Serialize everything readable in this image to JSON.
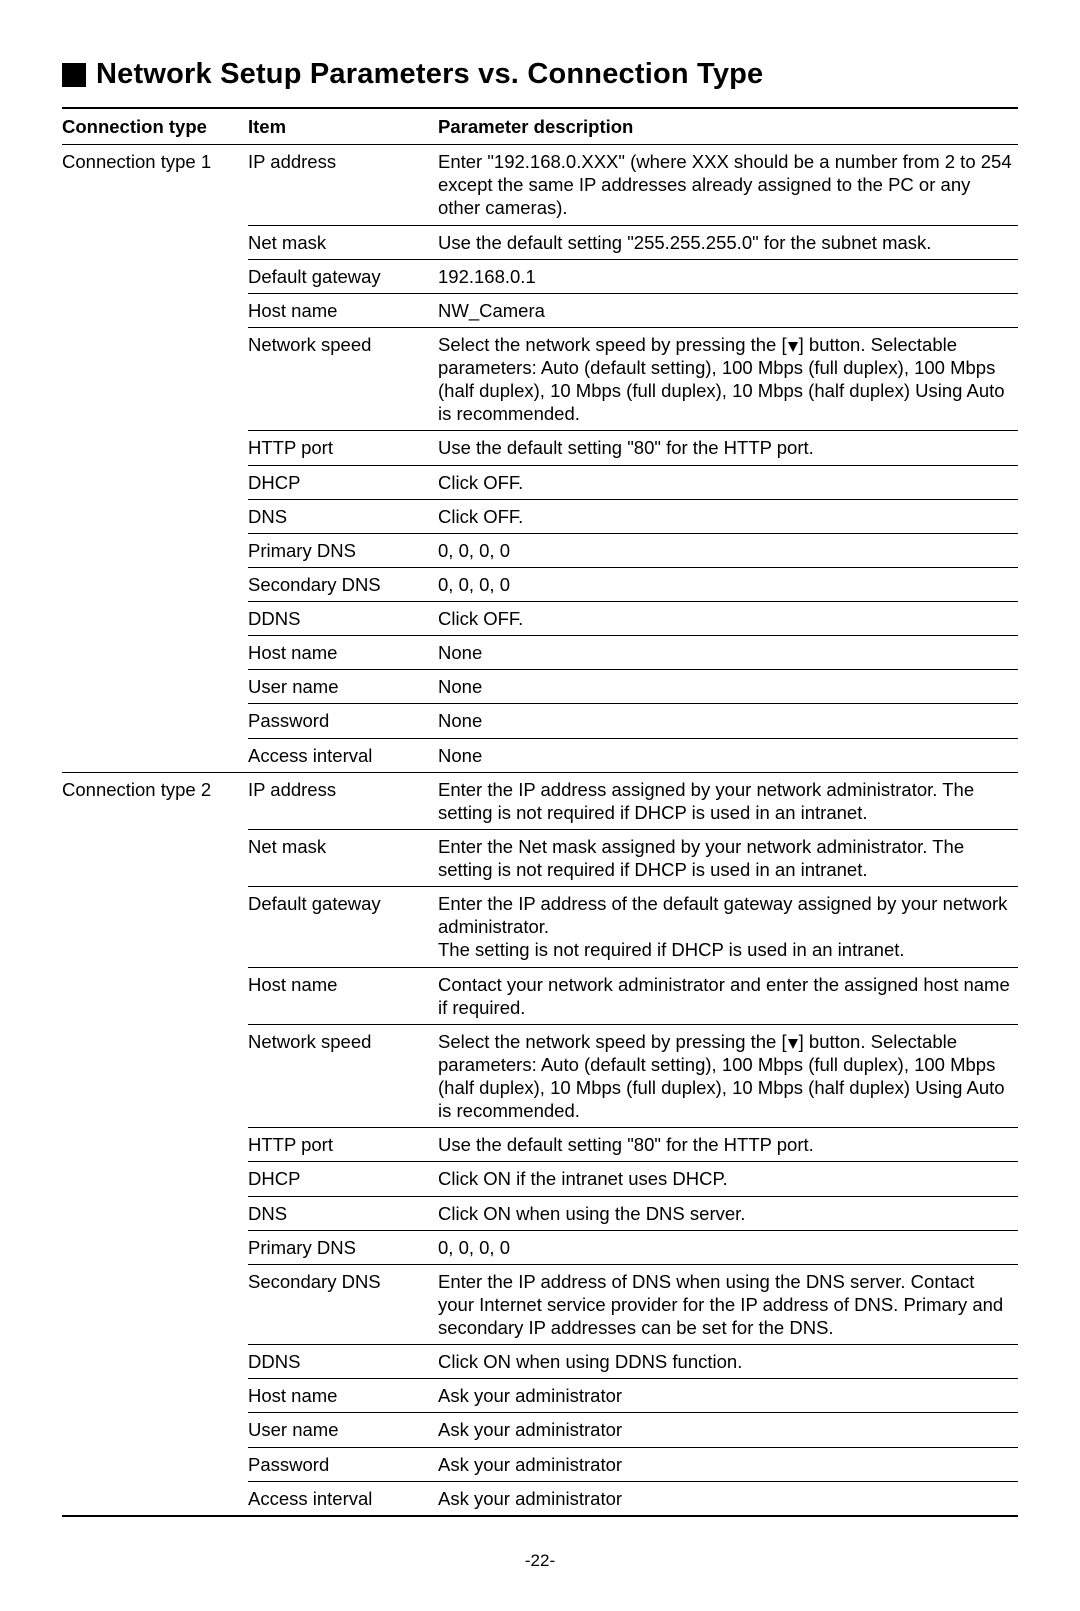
{
  "title": "Network Setup Parameters vs. Connection Type",
  "headers": {
    "conn": "Connection type",
    "item": "Item",
    "desc": "Parameter description"
  },
  "groups": [
    {
      "conn": "Connection type 1",
      "rows": [
        {
          "item": "IP address",
          "desc": "Enter \"192.168.0.XXX\" (where XXX should be a number from 2 to 254 except the same IP addresses already assigned to the PC or any other cameras)."
        },
        {
          "item": "Net mask",
          "desc": "Use the default setting \"255.255.255.0\" for the subnet mask."
        },
        {
          "item": "Default gateway",
          "desc": "192.168.0.1"
        },
        {
          "item": "Host name",
          "desc": "NW_Camera"
        },
        {
          "item": "Network speed",
          "desc_pre": "Select the network speed by pressing the [",
          "desc_post": "] button. Selectable parameters: Auto (default setting), 100 Mbps (full duplex), 100 Mbps (half duplex), 10 Mbps (full duplex), 10 Mbps (half duplex)  Using Auto is recommended.",
          "has_tri": true
        },
        {
          "item": "HTTP port",
          "desc": "Use the default setting \"80\" for the HTTP port."
        },
        {
          "item": "DHCP",
          "desc": "Click OFF."
        },
        {
          "item": "DNS",
          "desc": "Click OFF."
        },
        {
          "item": "Primary DNS",
          "desc": "0, 0, 0, 0"
        },
        {
          "item": "Secondary DNS",
          "desc": "0, 0, 0, 0"
        },
        {
          "item": "DDNS",
          "desc": "Click OFF."
        },
        {
          "item": "Host name",
          "desc": "None"
        },
        {
          "item": "User name",
          "desc": "None"
        },
        {
          "item": "Password",
          "desc": "None"
        },
        {
          "item": "Access interval",
          "desc": "None"
        }
      ]
    },
    {
      "conn": "Connection type 2",
      "rows": [
        {
          "item": "IP address",
          "desc": "Enter the IP address assigned by your network administrator. The setting is not required if DHCP is used in an intranet."
        },
        {
          "item": "Net mask",
          "desc": "Enter the Net mask assigned by your network administrator. The setting is not required if DHCP is used in an intranet."
        },
        {
          "item": "Default gateway",
          "desc": "Enter the IP address of the default gateway assigned by your network administrator.\nThe setting is not required if DHCP is used in an intranet."
        },
        {
          "item": "Host name",
          "desc": "Contact your network administrator and enter the assigned host name if required."
        },
        {
          "item": "Network speed",
          "desc_pre": "Select the network speed by pressing the [",
          "desc_post": "] button. Selectable parameters: Auto (default setting), 100 Mbps (full duplex), 100 Mbps (half duplex), 10 Mbps (full duplex), 10 Mbps (half duplex) Using Auto is recommended.",
          "has_tri": true
        },
        {
          "item": "HTTP port",
          "desc": "Use the default setting \"80\" for the HTTP port."
        },
        {
          "item": "DHCP",
          "desc": "Click ON if the intranet uses DHCP."
        },
        {
          "item": "DNS",
          "desc": "Click ON when using the DNS server."
        },
        {
          "item": "Primary DNS",
          "desc": "0, 0, 0, 0"
        },
        {
          "item": "Secondary DNS",
          "desc": "Enter the IP address of DNS when using the DNS server. Contact your Internet service provider for the IP address of DNS. Primary and secondary IP addresses can be set for the DNS."
        },
        {
          "item": "DDNS",
          "desc": "Click ON when using DDNS function."
        },
        {
          "item": "Host name",
          "desc": "Ask your administrator"
        },
        {
          "item": "User name",
          "desc": "Ask your administrator"
        },
        {
          "item": "Password",
          "desc": "Ask your administrator"
        },
        {
          "item": "Access interval",
          "desc": "Ask your administrator"
        }
      ]
    }
  ],
  "page_number": "-22-"
}
